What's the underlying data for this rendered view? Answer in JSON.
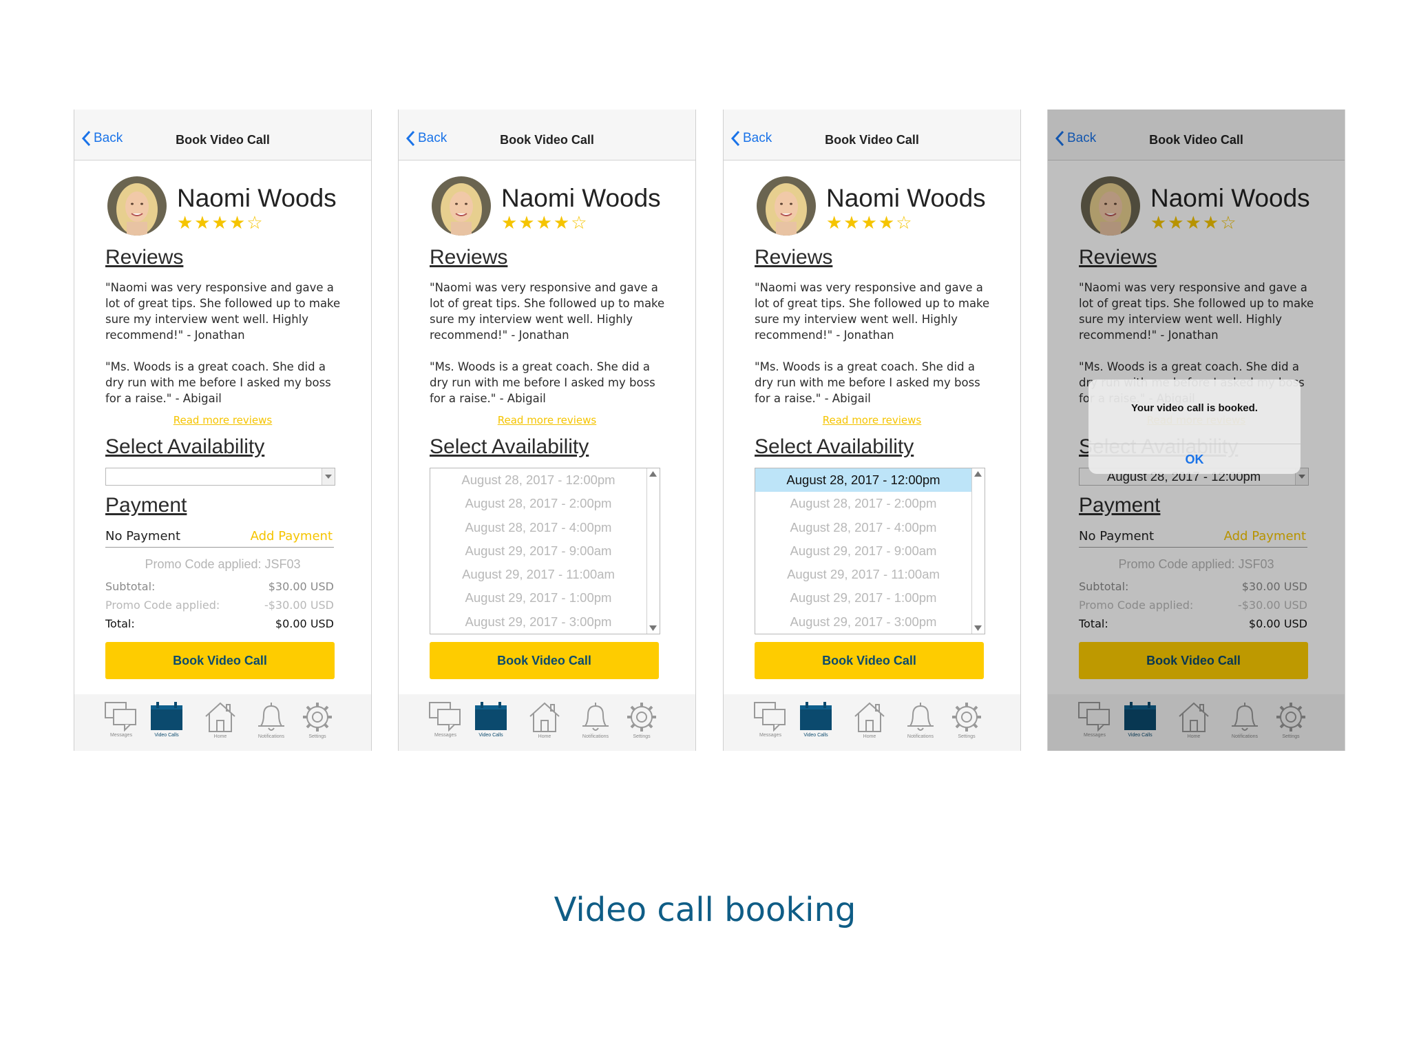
{
  "nav": {
    "back": "Back",
    "title": "Book Video Call"
  },
  "profile": {
    "name": "Naomi Woods",
    "stars": "★★★★☆",
    "rating": 4,
    "rating_max": 5
  },
  "reviews": {
    "heading": "Reviews",
    "items": [
      "\"Naomi was very responsive and gave a lot of great tips. She followed up to make sure my interview went well. Highly recommend!\" - Jonathan",
      "\"Ms. Woods is a great coach. She did a dry run with me before I asked my boss for a raise.\" - Abigail"
    ],
    "read_more": "Read more reviews"
  },
  "availability": {
    "heading": "Select Availability",
    "options": [
      "August 28, 2017 - 12:00pm",
      "August 28, 2017 - 2:00pm",
      "August 28, 2017 - 4:00pm",
      "August 29, 2017 - 9:00am",
      "August 29, 2017 - 11:00am",
      "August 29, 2017 - 1:00pm",
      "August 29, 2017 - 3:00pm"
    ],
    "selected": "August 28, 2017 - 12:00pm"
  },
  "payment": {
    "heading": "Payment",
    "method": "No Payment",
    "add_label": "Add Payment",
    "promo_applied": "Promo Code applied: JSF03",
    "subtotal_label": "Subtotal:",
    "subtotal_value": "$30.00 USD",
    "promo_label": "Promo Code applied:",
    "promo_value": "-$30.00 USD",
    "total_label": "Total:",
    "total_value": "$0.00 USD"
  },
  "book_button": "Book Video Call",
  "tabs": [
    {
      "label": "Messages",
      "icon": "messages-icon"
    },
    {
      "label": "Video Calls",
      "icon": "video-calls-icon"
    },
    {
      "label": "Home",
      "icon": "home-icon"
    },
    {
      "label": "Notifications",
      "icon": "bell-icon"
    },
    {
      "label": "Settings",
      "icon": "gear-icon"
    }
  ],
  "alert": {
    "message": "Your video call is booked.",
    "ok": "OK"
  },
  "caption": "Video call booking",
  "colors": {
    "accent": "#fecc00",
    "link": "#1a73e8",
    "brand": "#0b4a6e",
    "caption": "#0f5d86"
  }
}
